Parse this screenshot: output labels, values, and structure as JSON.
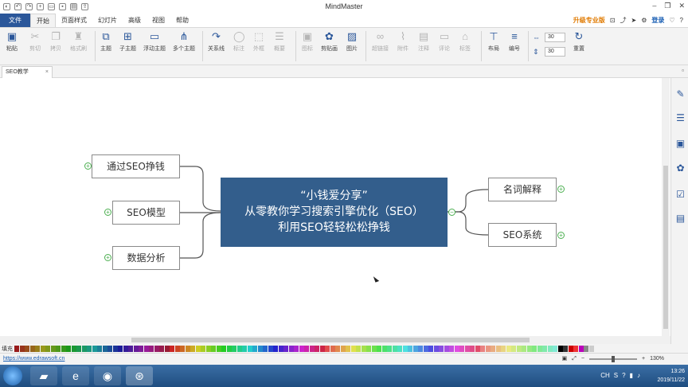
{
  "window": {
    "title": "MindMaster"
  },
  "menu": {
    "file": "文件",
    "items": [
      "开始",
      "页面样式",
      "幻灯片",
      "高级",
      "视图",
      "帮助"
    ],
    "upgrade": "升级专业版",
    "login": "登录"
  },
  "ribbon": {
    "paste": "粘贴",
    "cut": "剪切",
    "copy": "拷贝",
    "format_painter": "格式刷",
    "topic": "主题",
    "subtopic": "子主题",
    "floating_topic": "浮动主题",
    "multi_topic": "多个主题",
    "relation": "关系线",
    "callout": "标注",
    "boundary": "外框",
    "summary": "概要",
    "icon": "图标",
    "clipart": "剪贴画",
    "picture": "图片",
    "hyperlink": "超链接",
    "attachment": "附件",
    "note": "注释",
    "comment": "评论",
    "tag": "标签",
    "layout": "布局",
    "numbering": "编号",
    "reset": "重置",
    "spin1": "30",
    "spin2": "30"
  },
  "doc_tab": {
    "label": "SEO教学"
  },
  "mindmap": {
    "central": [
      "“小钱爱分享”",
      "从零教你学习搜索引擎优化（SEO）",
      "利用SEO轻轻松松挣钱"
    ],
    "left_topics": [
      "通过SEO挣钱",
      "SEO模型",
      "数据分析"
    ],
    "right_topics": [
      "名词解释",
      "SEO系统"
    ]
  },
  "palette": {
    "fill_label": "填充"
  },
  "status": {
    "link": "https://www.edrawsoft.cn",
    "zoom": "130%"
  },
  "taskbar": {
    "time": "13:26",
    "date": "2019/11/22",
    "lang": "CH"
  },
  "colors": {
    "accent": "#2b579a",
    "central_fill": "#335e8c",
    "expand": "#4caf50"
  }
}
